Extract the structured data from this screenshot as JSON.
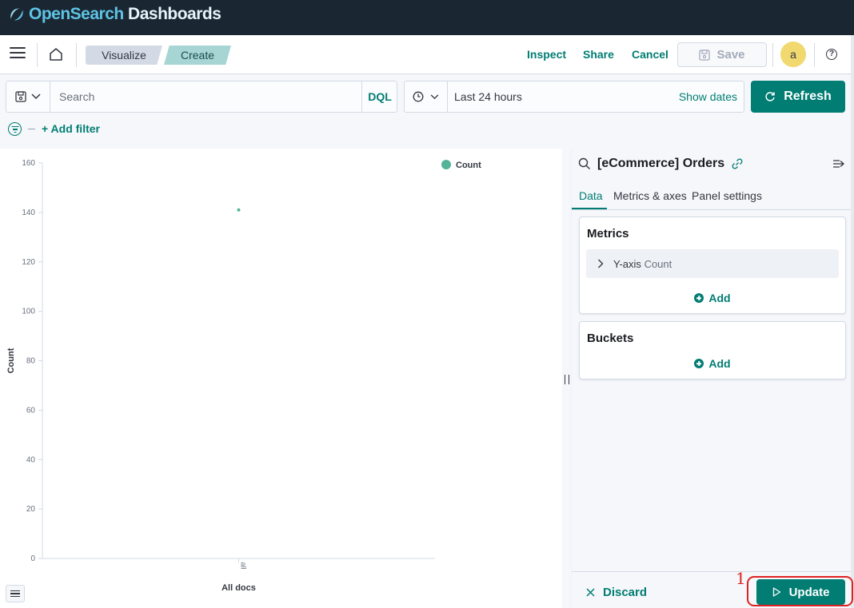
{
  "app": {
    "brand_prefix": "Open",
    "brand_mid": "Search",
    "brand_suffix": " Dashboards"
  },
  "header": {
    "breadcrumbs": [
      "Visualize",
      "Create"
    ],
    "inspect": "Inspect",
    "share": "Share",
    "cancel": "Cancel",
    "save": "Save",
    "avatar": "a"
  },
  "query": {
    "placeholder": "Search",
    "language": "DQL",
    "time_range": "Last 24 hours",
    "show_dates": "Show dates",
    "refresh": "Refresh",
    "add_filter": "+ Add filter"
  },
  "chart_data": {
    "type": "scatter",
    "categories": [
      "All docs"
    ],
    "series": [
      {
        "name": "Count",
        "values": [
          141
        ]
      }
    ],
    "ylabel": "Count",
    "xlabel": "All docs",
    "x_tick": "all",
    "ylim": [
      0,
      160
    ],
    "yticks": [
      0,
      20,
      40,
      60,
      80,
      100,
      120,
      140,
      160
    ],
    "legend_position": "top-right",
    "color": "#54b399"
  },
  "sidebar": {
    "index_pattern": "[eCommerce] Orders",
    "tabs": [
      "Data",
      "Metrics & axes",
      "Panel settings"
    ],
    "metrics": {
      "title": "Metrics",
      "agg_label": "Y-axis",
      "agg_value": "Count",
      "add": "Add"
    },
    "buckets": {
      "title": "Buckets",
      "add": "Add"
    },
    "discard": "Discard",
    "update": "Update"
  },
  "annotation": {
    "label": "1",
    "color": "#e02020"
  }
}
